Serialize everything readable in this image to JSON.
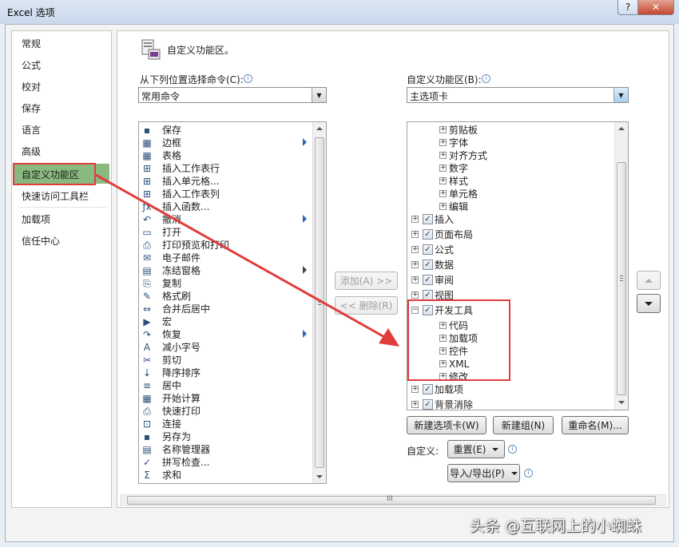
{
  "window": {
    "title": "Excel 选项",
    "help_label": "?",
    "close_label": "✕"
  },
  "nav": {
    "items": [
      "常规",
      "公式",
      "校对",
      "保存",
      "语言",
      "高级",
      "自定义功能区",
      "快速访问工具栏",
      "加载项",
      "信任中心"
    ],
    "selected": "自定义功能区"
  },
  "header": {
    "title": "自定义功能区。"
  },
  "left_panel": {
    "label": "从下列位置选择命令(C):",
    "dropdown_value": "常用命令",
    "commands": [
      {
        "label": "保存",
        "icon": "save-icon",
        "glyph": "▪"
      },
      {
        "label": "边框",
        "icon": "border-icon",
        "glyph": "▦",
        "submenu": true
      },
      {
        "label": "表格",
        "icon": "table-icon",
        "glyph": "▦"
      },
      {
        "label": "插入工作表行",
        "icon": "insert-row-icon",
        "glyph": "⊞"
      },
      {
        "label": "插入单元格...",
        "icon": "insert-cell-icon",
        "glyph": "⊞"
      },
      {
        "label": "插入工作表列",
        "icon": "insert-column-icon",
        "glyph": "⊞"
      },
      {
        "label": "插入函数...",
        "icon": "function-icon",
        "glyph": "ƒx"
      },
      {
        "label": "撤消",
        "icon": "undo-icon",
        "glyph": "↶",
        "submenu": true
      },
      {
        "label": "打开",
        "icon": "open-folder-icon",
        "glyph": "▭"
      },
      {
        "label": "打印预览和打印",
        "icon": "print-preview-icon",
        "glyph": "⎙"
      },
      {
        "label": "电子邮件",
        "icon": "email-icon",
        "glyph": "✉"
      },
      {
        "label": "冻结窗格",
        "icon": "freeze-panes-icon",
        "glyph": "▤",
        "submenu": true
      },
      {
        "label": "复制",
        "icon": "copy-icon",
        "glyph": "⎘"
      },
      {
        "label": "格式刷",
        "icon": "format-painter-icon",
        "glyph": "✎"
      },
      {
        "label": "合并后居中",
        "icon": "merge-center-icon",
        "glyph": "⇔"
      },
      {
        "label": "宏",
        "icon": "macro-icon",
        "glyph": "▶"
      },
      {
        "label": "恢复",
        "icon": "redo-icon",
        "glyph": "↷",
        "submenu": true
      },
      {
        "label": "减小字号",
        "icon": "decrease-font-icon",
        "glyph": "A"
      },
      {
        "label": "剪切",
        "icon": "cut-icon",
        "glyph": "✂"
      },
      {
        "label": "降序排序",
        "icon": "sort-descending-icon",
        "glyph": "↓"
      },
      {
        "label": "居中",
        "icon": "align-center-icon",
        "glyph": "≡"
      },
      {
        "label": "开始计算",
        "icon": "calculator-icon",
        "glyph": "▦"
      },
      {
        "label": "快速打印",
        "icon": "quick-print-icon",
        "glyph": "⎙"
      },
      {
        "label": "连接",
        "icon": "connections-icon",
        "glyph": "⊡"
      },
      {
        "label": "另存为",
        "icon": "save-as-icon",
        "glyph": "▪"
      },
      {
        "label": "名称管理器",
        "icon": "name-manager-icon",
        "glyph": "▤"
      },
      {
        "label": "拼写检查...",
        "icon": "spelling-icon",
        "glyph": "✓"
      },
      {
        "label": "求和",
        "icon": "sum-icon",
        "glyph": "Σ"
      }
    ]
  },
  "middle": {
    "add_label": "添加(A) >>",
    "remove_label": "<< 删除(R)"
  },
  "right_panel": {
    "label": "自定义功能区(B):",
    "dropdown_value": "主选项卡",
    "tree": [
      {
        "label": "剪贴板",
        "level": 2,
        "checkbox": false
      },
      {
        "label": "字体",
        "level": 2,
        "checkbox": false
      },
      {
        "label": "对齐方式",
        "level": 2,
        "checkbox": false
      },
      {
        "label": "数字",
        "level": 2,
        "checkbox": false
      },
      {
        "label": "样式",
        "level": 2,
        "checkbox": false
      },
      {
        "label": "单元格",
        "level": 2,
        "checkbox": false
      },
      {
        "label": "编辑",
        "level": 2,
        "checkbox": false
      },
      {
        "label": "插入",
        "level": 1,
        "checkbox": true,
        "checked": true
      },
      {
        "label": "页面布局",
        "level": 1,
        "checkbox": true,
        "checked": true
      },
      {
        "label": "公式",
        "level": 1,
        "checkbox": true,
        "checked": true
      },
      {
        "label": "数据",
        "level": 1,
        "checkbox": true,
        "checked": true
      },
      {
        "label": "审阅",
        "level": 1,
        "checkbox": true,
        "checked": true
      },
      {
        "label": "视图",
        "level": 1,
        "checkbox": true,
        "checked": true
      },
      {
        "label": "开发工具",
        "level": 1,
        "checkbox": true,
        "checked": true,
        "expanded": true
      },
      {
        "label": "代码",
        "level": 2,
        "checkbox": false
      },
      {
        "label": "加载项",
        "level": 2,
        "checkbox": false
      },
      {
        "label": "控件",
        "level": 2,
        "checkbox": false
      },
      {
        "label": "XML",
        "level": 2,
        "checkbox": false
      },
      {
        "label": "修改",
        "level": 2,
        "checkbox": false
      },
      {
        "label": "加载项",
        "level": 1,
        "checkbox": true,
        "checked": true
      },
      {
        "label": "背景消除",
        "level": 1,
        "checkbox": true,
        "checked": true
      }
    ],
    "new_tab_label": "新建选项卡(W)",
    "new_group_label": "新建组(N)",
    "rename_label": "重命名(M)...",
    "customize_label": "自定义:",
    "reset_label": "重置(E)",
    "import_export_label": "导入/导出(P)"
  },
  "hscroll_grip": "III",
  "watermark": "头条 @互联网上的小蜘蛛",
  "colors": {
    "selection": "#8ab97f",
    "highlight_box": "#e03c3c",
    "arrow": "#e03c3c"
  }
}
